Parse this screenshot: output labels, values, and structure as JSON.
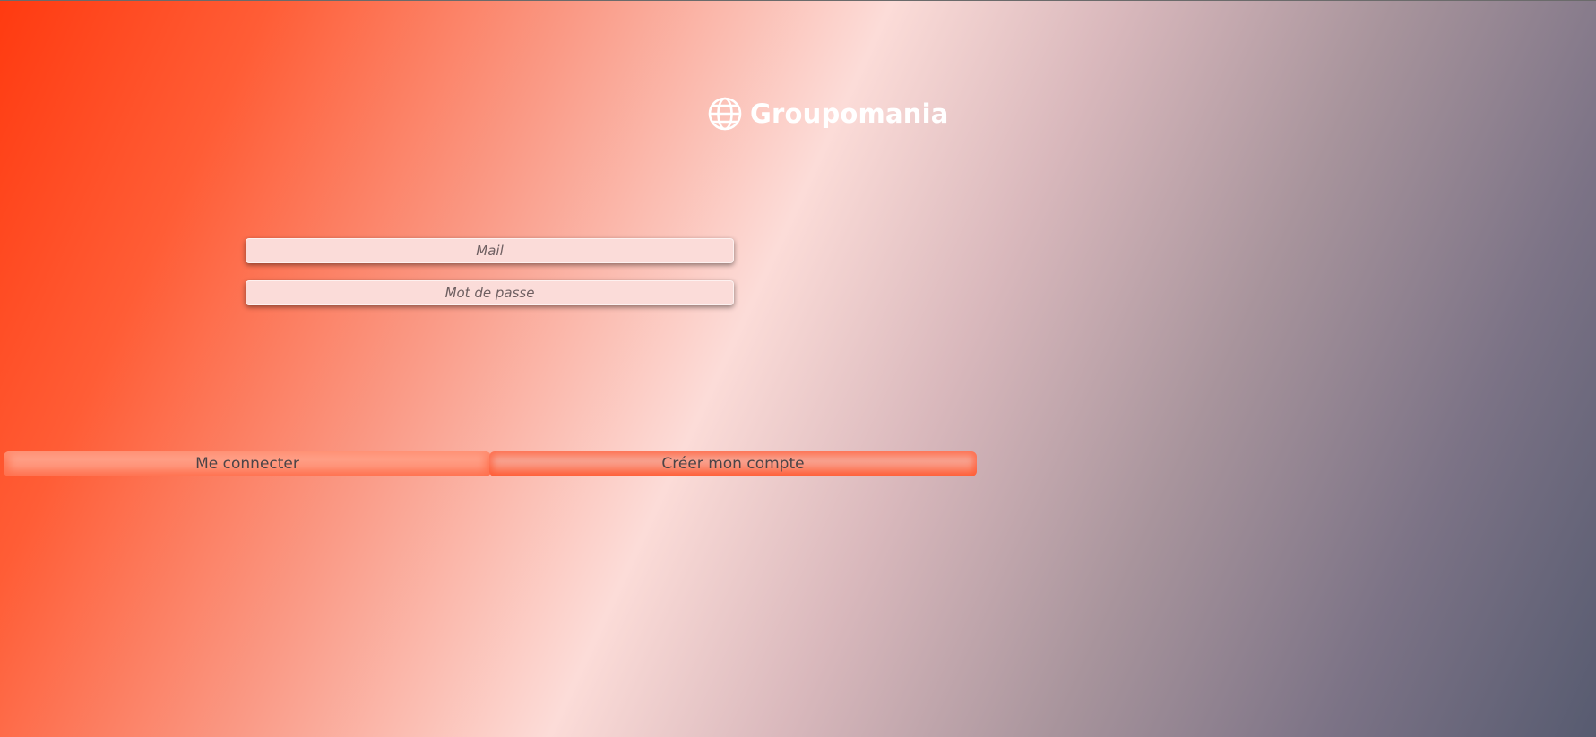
{
  "header": {
    "brand_name": "Groupomania",
    "logo_icon": "globe-icon"
  },
  "login_form": {
    "mail_placeholder": "Mail",
    "mail_value": "",
    "password_placeholder": "Mot de passe",
    "password_value": ""
  },
  "actions": {
    "login_label": "Me connecter",
    "signup_label": "Créer mon compte"
  },
  "colors": {
    "brand_accent": "#FD2D01",
    "field_background": "#FBDCD9",
    "dark_tone": "#575B70"
  }
}
